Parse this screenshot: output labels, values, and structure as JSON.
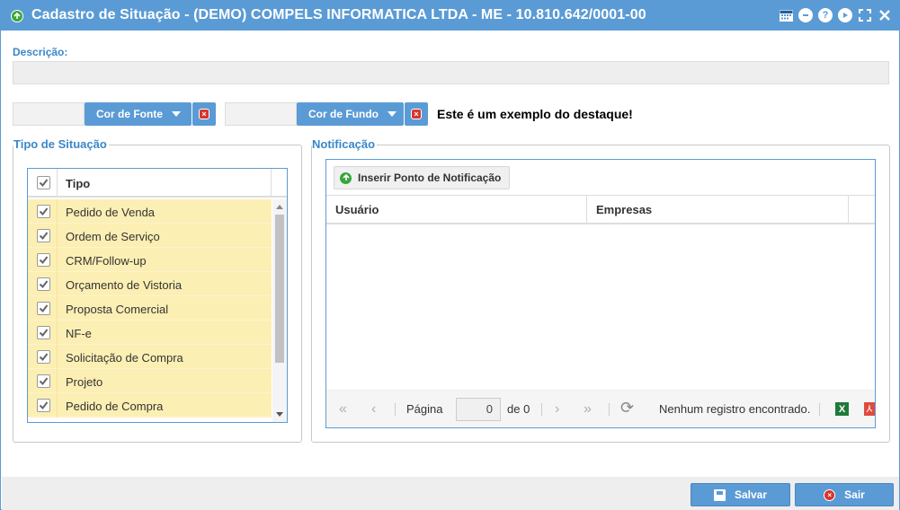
{
  "window": {
    "title": "Cadastro de Situação - (DEMO) COMPELS INFORMATICA LTDA - ME - 10.810.642/0001-00",
    "controls": [
      "calendar-icon",
      "minimize-icon",
      "help-icon",
      "play-icon",
      "fullscreen-icon",
      "close-icon"
    ],
    "help_glyph": "?"
  },
  "description": {
    "label": "Descrição:",
    "value": ""
  },
  "colors": {
    "font_button": "Cor de Fonte",
    "background_button": "Cor de Fundo",
    "example_text": "Este é um exemplo do destaque!"
  },
  "tipo_situacao": {
    "legend": "Tipo de Situação",
    "column_header": "Tipo",
    "rows": [
      {
        "label": "Pedido de Venda",
        "checked": true
      },
      {
        "label": "Ordem de Serviço",
        "checked": true
      },
      {
        "label": "CRM/Follow-up",
        "checked": true
      },
      {
        "label": "Orçamento de Vistoria",
        "checked": true
      },
      {
        "label": "Proposta Comercial",
        "checked": true
      },
      {
        "label": "NF-e",
        "checked": true
      },
      {
        "label": "Solicitação de Compra",
        "checked": true
      },
      {
        "label": "Projeto",
        "checked": true
      },
      {
        "label": "Pedido de Compra",
        "checked": true
      }
    ]
  },
  "notificacao": {
    "legend": "Notificação",
    "insert_button": "Inserir Ponto de Notificação",
    "columns": [
      "Usuário",
      "Empresas"
    ],
    "pager": {
      "page_label": "Página",
      "page_value": "0",
      "of_label": "de 0",
      "status": "Nenhum registro encontrado.",
      "excel_glyph": "X"
    }
  },
  "footer": {
    "save": "Salvar",
    "exit": "Sair"
  },
  "theme": {
    "accent": "#5b9bd5",
    "highlight_row": "#fcefb4",
    "legend_color": "#3a87c8"
  }
}
